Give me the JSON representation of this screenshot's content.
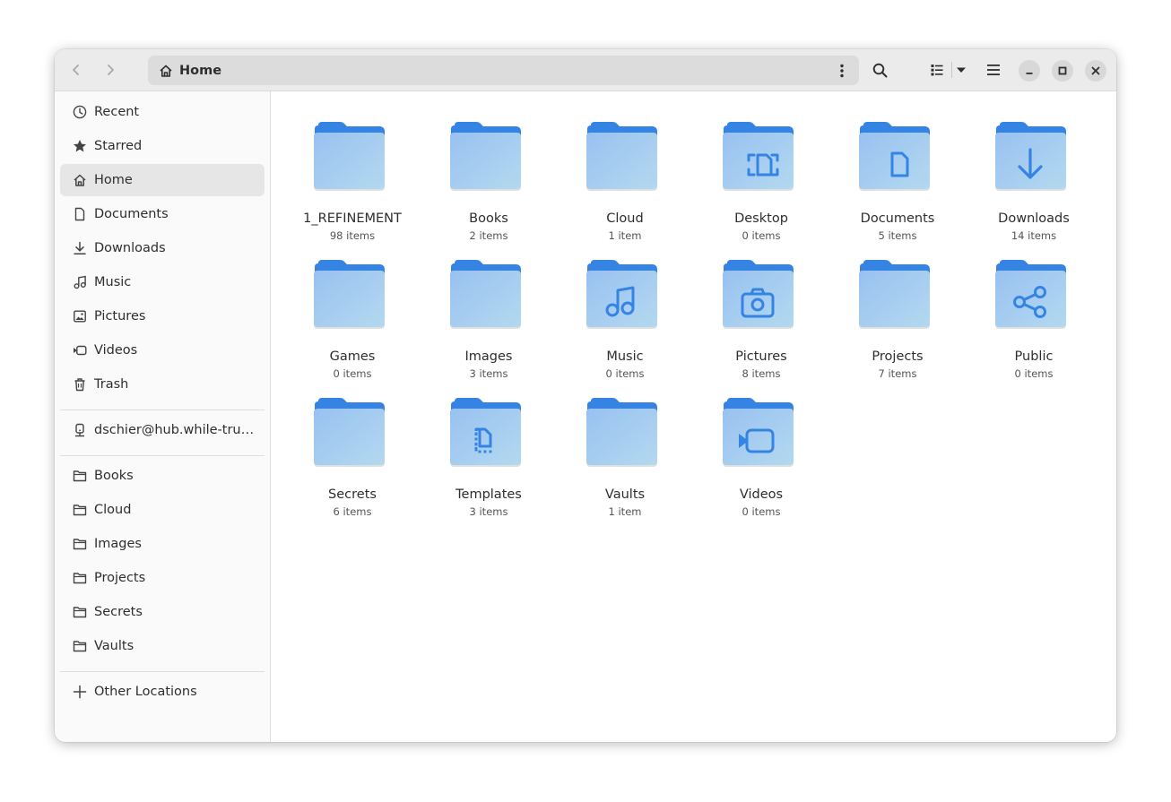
{
  "pathbar": {
    "location": "Home"
  },
  "sidebar": {
    "places": [
      {
        "label": "Recent",
        "icon": "clock-icon"
      },
      {
        "label": "Starred",
        "icon": "star-icon"
      },
      {
        "label": "Home",
        "icon": "home-icon",
        "active": true
      },
      {
        "label": "Documents",
        "icon": "document-icon"
      },
      {
        "label": "Downloads",
        "icon": "download-icon"
      },
      {
        "label": "Music",
        "icon": "music-icon"
      },
      {
        "label": "Pictures",
        "icon": "image-icon"
      },
      {
        "label": "Videos",
        "icon": "video-icon"
      },
      {
        "label": "Trash",
        "icon": "trash-icon"
      }
    ],
    "network": [
      {
        "label": "dschier@hub.while-true.net",
        "icon": "network-drive-icon"
      }
    ],
    "bookmarks": [
      {
        "label": "Books",
        "icon": "folder-icon"
      },
      {
        "label": "Cloud",
        "icon": "folder-icon"
      },
      {
        "label": "Images",
        "icon": "folder-icon"
      },
      {
        "label": "Projects",
        "icon": "folder-icon"
      },
      {
        "label": "Secrets",
        "icon": "folder-icon"
      },
      {
        "label": "Vaults",
        "icon": "folder-icon"
      }
    ],
    "other": {
      "label": "Other Locations",
      "icon": "plus-icon"
    }
  },
  "folders": [
    {
      "name": "1_REFINEMENT",
      "count": "98 items",
      "emblem": ""
    },
    {
      "name": "Books",
      "count": "2 items",
      "emblem": ""
    },
    {
      "name": "Cloud",
      "count": "1 item",
      "emblem": ""
    },
    {
      "name": "Desktop",
      "count": "0 items",
      "emblem": "desktop"
    },
    {
      "name": "Documents",
      "count": "5 items",
      "emblem": "document"
    },
    {
      "name": "Downloads",
      "count": "14 items",
      "emblem": "download"
    },
    {
      "name": "Games",
      "count": "0 items",
      "emblem": ""
    },
    {
      "name": "Images",
      "count": "3 items",
      "emblem": ""
    },
    {
      "name": "Music",
      "count": "0 items",
      "emblem": "music"
    },
    {
      "name": "Pictures",
      "count": "8 items",
      "emblem": "camera"
    },
    {
      "name": "Projects",
      "count": "7 items",
      "emblem": ""
    },
    {
      "name": "Public",
      "count": "0 items",
      "emblem": "share"
    },
    {
      "name": "Secrets",
      "count": "6 items",
      "emblem": ""
    },
    {
      "name": "Templates",
      "count": "3 items",
      "emblem": "template"
    },
    {
      "name": "Vaults",
      "count": "1 item",
      "emblem": ""
    },
    {
      "name": "Videos",
      "count": "0 items",
      "emblem": "video"
    }
  ],
  "colors": {
    "folder_back": "#3584e4",
    "folder_front_top": "#99c1f1",
    "folder_front_bottom": "#b3d9ef",
    "emblem": "#3584e4"
  }
}
